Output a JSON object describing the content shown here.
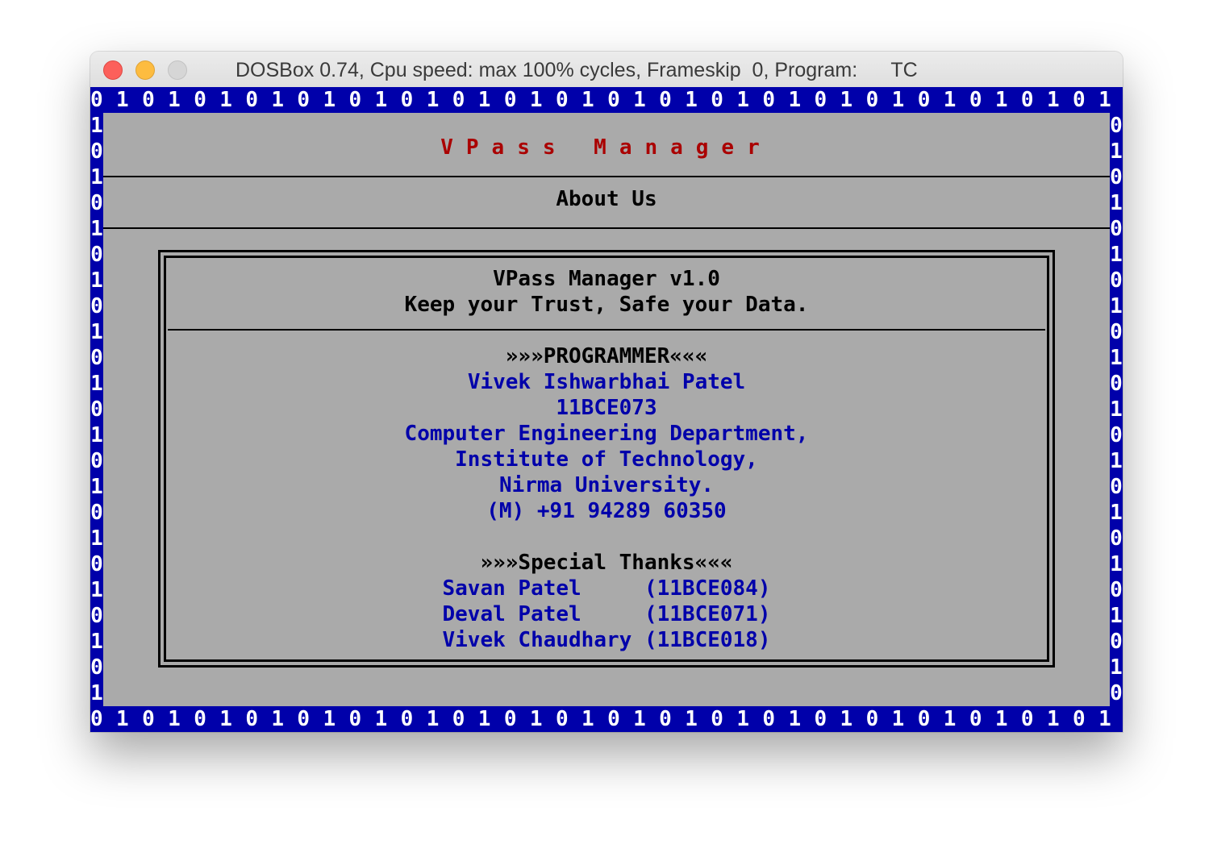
{
  "window": {
    "title": "DOSBox 0.74, Cpu speed: max 100% cycles, Frameskip  0, Program:      TC"
  },
  "colors": {
    "border_bg": "#0000aa",
    "screen_bg": "#aaaaaa",
    "title_red": "#aa0000",
    "text_blue": "#0000aa",
    "text_black": "#000000"
  },
  "border": {
    "top_row": "01010101010101010101010101010101010101010101010101010101010101010101010101010101",
    "bottom_row": "01010101010101010101010101010101010101010101010101010101010101010101010101010101",
    "left_col": [
      "1",
      "0",
      "1",
      "0",
      "1",
      "0",
      "1",
      "0",
      "1",
      "0",
      "1",
      "0",
      "1",
      "0",
      "1",
      "0",
      "1",
      "0",
      "1",
      "0",
      "1",
      "0",
      "1"
    ],
    "right_col": [
      "0",
      "1",
      "0",
      "1",
      "0",
      "1",
      "0",
      "1",
      "0",
      "1",
      "0",
      "1",
      "0",
      "1",
      "0",
      "1",
      "0",
      "1",
      "0",
      "1",
      "0",
      "1",
      "0"
    ]
  },
  "header": {
    "app_title": "VPass Manager",
    "section_title": "About Us"
  },
  "about": {
    "product": "VPass Manager v1.0",
    "tagline": "Keep your Trust, Safe your Data.",
    "programmer_heading": "»»»PROGRAMMER«««",
    "programmer_name": "Vivek Ishwarbhai Patel",
    "programmer_id": "11BCE073",
    "department": "Computer Engineering Department,",
    "institute": "Institute of Technology,",
    "university": "Nirma University.",
    "mobile": "(M) +91 94289 60350",
    "thanks_heading": "»»»Special Thanks«««",
    "thanks": [
      "Savan Patel     (11BCE084)",
      "Deval Patel     (11BCE071)",
      "Vivek Chaudhary (11BCE018)"
    ]
  }
}
